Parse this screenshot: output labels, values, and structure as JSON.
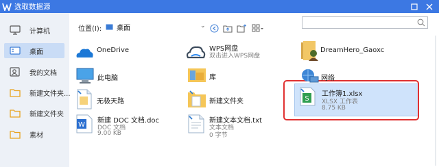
{
  "window": {
    "title": "选取数据源"
  },
  "sidebar": {
    "items": [
      {
        "label": "计算机",
        "icon": "computer-icon"
      },
      {
        "label": "桌面",
        "icon": "desktop-icon",
        "selected": true
      },
      {
        "label": "我的文档",
        "icon": "documents-icon"
      },
      {
        "label": "新建文件夹...",
        "icon": "folder-icon"
      },
      {
        "label": "新建文件夹",
        "icon": "folder-icon"
      },
      {
        "label": "素材",
        "icon": "folder-icon"
      }
    ]
  },
  "toolbar": {
    "location_label": "位置(I):",
    "location_value": "桌面",
    "search_placeholder": ""
  },
  "files": {
    "onedrive": {
      "name": "OneDrive"
    },
    "wps": {
      "name": "WPS网盘",
      "sub": "双击进入WPS网盘"
    },
    "user": {
      "name": "DreamHero_Gaoxc"
    },
    "pc": {
      "name": "此电脑"
    },
    "library": {
      "name": "库"
    },
    "network": {
      "name": "网络"
    },
    "shortcut": {
      "name": "无极天路"
    },
    "newfolder": {
      "name": "新建文件夹"
    },
    "xlsx": {
      "name": "工作簿1.xlsx",
      "type": "XLSX 工作表",
      "size": "8.75 KB"
    },
    "doc": {
      "name": "新建 DOC 文档.doc",
      "type": "DOC 文档",
      "size": "9.00 KB"
    },
    "txt": {
      "name": "新建文本文档.txt",
      "type": "文本文档",
      "size": "0 字节"
    }
  },
  "colors": {
    "titlebar": "#3c78e3",
    "sidebar": "#edf1f7",
    "selection": "#cfe3fb",
    "annotation": "#e03030"
  }
}
